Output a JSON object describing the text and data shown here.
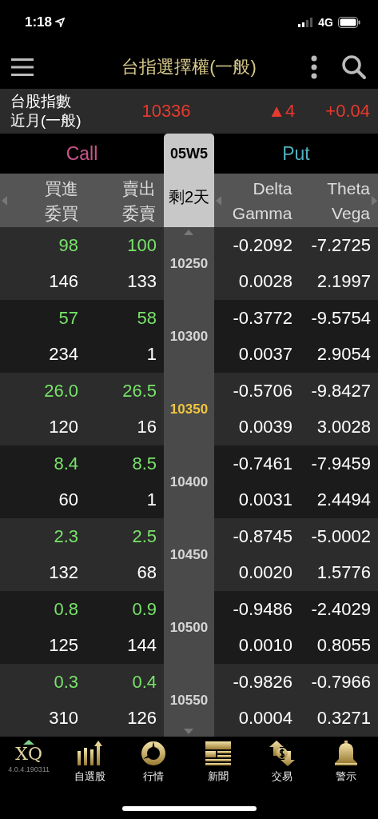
{
  "status_bar": {
    "time": "1:18",
    "network": "4G"
  },
  "header": {
    "title": "台指選擇權(一般)"
  },
  "index_quote": {
    "name_line1": "台股指數",
    "name_line2": "近月(一般)",
    "price": "10336",
    "change": "▲4",
    "change_pct": "+0.04"
  },
  "option_tabs": {
    "call": "Call",
    "put": "Put",
    "expiry": "05W5",
    "days_left": "剩2天"
  },
  "columns": {
    "call": [
      {
        "top": "買進",
        "bottom": "委買"
      },
      {
        "top": "賣出",
        "bottom": "委賣"
      }
    ],
    "greeks": [
      {
        "top": "Delta",
        "bottom": "Gamma"
      },
      {
        "top": "Theta",
        "bottom": "Vega"
      }
    ]
  },
  "rows": [
    {
      "strike": "10250",
      "at_money": false,
      "bid": "98",
      "ask": "100",
      "bid_size": "146",
      "ask_size": "133",
      "delta": "-0.2092",
      "theta": "-7.2725",
      "gamma": "0.0028",
      "vega": "2.1997"
    },
    {
      "strike": "10300",
      "at_money": false,
      "bid": "57",
      "ask": "58",
      "bid_size": "234",
      "ask_size": "1",
      "delta": "-0.3772",
      "theta": "-9.5754",
      "gamma": "0.0037",
      "vega": "2.9054"
    },
    {
      "strike": "10350",
      "at_money": true,
      "bid": "26.0",
      "ask": "26.5",
      "bid_size": "120",
      "ask_size": "16",
      "delta": "-0.5706",
      "theta": "-9.8427",
      "gamma": "0.0039",
      "vega": "3.0028"
    },
    {
      "strike": "10400",
      "at_money": false,
      "bid": "8.4",
      "ask": "8.5",
      "bid_size": "60",
      "ask_size": "1",
      "delta": "-0.7461",
      "theta": "-7.9459",
      "gamma": "0.0031",
      "vega": "2.4494"
    },
    {
      "strike": "10450",
      "at_money": false,
      "bid": "2.3",
      "ask": "2.5",
      "bid_size": "132",
      "ask_size": "68",
      "delta": "-0.8745",
      "theta": "-5.0002",
      "gamma": "0.0020",
      "vega": "1.5776"
    },
    {
      "strike": "10500",
      "at_money": false,
      "bid": "0.8",
      "ask": "0.9",
      "bid_size": "125",
      "ask_size": "144",
      "delta": "-0.9486",
      "theta": "-2.4029",
      "gamma": "0.0010",
      "vega": "0.8055"
    },
    {
      "strike": "10550",
      "at_money": false,
      "bid": "0.3",
      "ask": "0.4",
      "bid_size": "310",
      "ask_size": "126",
      "delta": "-0.9826",
      "theta": "-0.7966",
      "gamma": "0.0004",
      "vega": "0.3271"
    }
  ],
  "tab_bar": {
    "logo": "XQ",
    "version": "4.0.4.190311",
    "items": [
      {
        "label": "自選股",
        "kind": "bars"
      },
      {
        "label": "行情",
        "kind": "dial"
      },
      {
        "label": "新聞",
        "kind": "news"
      },
      {
        "label": "交易",
        "kind": "trade"
      },
      {
        "label": "警示",
        "kind": "bell"
      }
    ]
  }
}
